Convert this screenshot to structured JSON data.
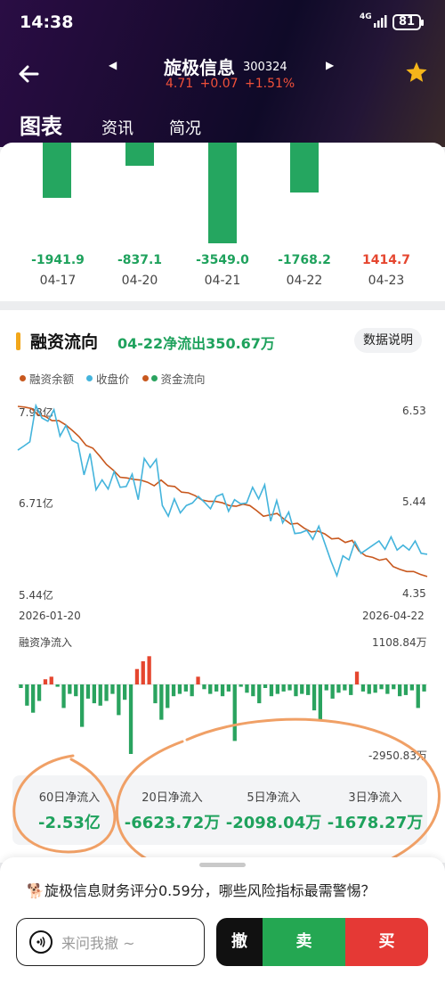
{
  "status_bar": {
    "time": "14:38",
    "network": "4G",
    "battery": "81"
  },
  "header": {
    "stock_name": "旋极信息",
    "stock_code": "300324",
    "quote": "4.71 +0.07 +1.51%",
    "tabs": [
      "图表",
      "资讯",
      "简况"
    ]
  },
  "daily_flows": {
    "items": [
      {
        "value": "-1941.9",
        "date": "04-17",
        "color": "#1fa25d"
      },
      {
        "value": "-837.1",
        "date": "04-20",
        "color": "#1fa25d"
      },
      {
        "value": "-3549.0",
        "date": "04-21",
        "color": "#1fa25d"
      },
      {
        "value": "-1768.2",
        "date": "04-22",
        "color": "#1fa25d"
      },
      {
        "value": "1414.7",
        "date": "04-23",
        "color": "#e5462f"
      }
    ]
  },
  "margin": {
    "title": "融资流向",
    "subtitle": "04-22净流出350.67万",
    "info_button": "数据说明",
    "legend": [
      "融资余额",
      "收盘价",
      "资金流向"
    ],
    "y_left": [
      "7.98亿",
      "6.71亿",
      "5.44亿"
    ],
    "y_right": [
      "6.53",
      "5.44",
      "4.35"
    ],
    "x_labels": [
      "2026-01-20",
      "2026-04-22"
    ],
    "flow_title": "融资净流入",
    "flow_max": "1108.84万",
    "flow_min": "-2950.83万",
    "summary": [
      {
        "label": "60日净流入",
        "value": "-2.53亿"
      },
      {
        "label": "20日净流入",
        "value": "-6623.72万"
      },
      {
        "label": "5日净流入",
        "value": "-2098.04万"
      },
      {
        "label": "3日净流入",
        "value": "-1678.27万"
      }
    ]
  },
  "chart_data": {
    "type": "line",
    "x_range": [
      "2026-01-20",
      "2026-04-22"
    ],
    "series": [
      {
        "name": "融资余额",
        "axis": "left",
        "unit": "亿",
        "color": "#c8581e",
        "values": [
          7.98,
          7.97,
          7.95,
          7.86,
          7.84,
          7.78,
          7.78,
          7.72,
          7.64,
          7.55,
          7.43,
          7.39,
          7.28,
          7.16,
          7.08,
          6.98,
          6.97,
          6.95,
          6.94,
          6.91,
          6.86,
          6.94,
          6.86,
          6.85,
          6.77,
          6.76,
          6.72,
          6.66,
          6.64,
          6.64,
          6.62,
          6.58,
          6.57,
          6.6,
          6.58,
          6.51,
          6.43,
          6.45,
          6.47,
          6.39,
          6.32,
          6.33,
          6.26,
          6.21,
          6.22,
          6.18,
          6.11,
          6.12,
          6.06,
          6.09,
          5.94,
          5.87,
          5.85,
          5.81,
          5.83,
          5.72,
          5.68,
          5.65,
          5.65,
          5.61,
          5.58
        ]
      },
      {
        "name": "收盘价",
        "axis": "right",
        "color": "#44b4dc",
        "values": [
          6.0,
          6.05,
          6.1,
          6.54,
          6.39,
          6.35,
          6.49,
          6.17,
          6.3,
          6.12,
          6.08,
          5.7,
          5.96,
          5.52,
          5.64,
          5.53,
          5.74,
          5.55,
          5.56,
          5.71,
          5.4,
          5.9,
          5.79,
          5.89,
          5.33,
          5.2,
          5.41,
          5.24,
          5.33,
          5.36,
          5.44,
          5.37,
          5.29,
          5.44,
          5.47,
          5.26,
          5.4,
          5.35,
          5.36,
          5.55,
          5.41,
          5.58,
          5.14,
          5.39,
          5.12,
          5.25,
          4.99,
          5.0,
          5.03,
          4.92,
          5.08,
          4.87,
          4.66,
          4.48,
          4.72,
          4.67,
          4.89,
          4.75,
          4.8,
          4.85,
          4.9,
          4.8,
          4.95,
          4.79,
          4.85,
          4.79,
          4.9,
          4.75,
          4.74
        ]
      }
    ],
    "flow": {
      "name": "融资净流入",
      "unit": "万",
      "max": 1108.84,
      "min": -2950.83,
      "values": [
        -150,
        -900,
        -1200,
        -700,
        200,
        300,
        -100,
        -1000,
        -400,
        -500,
        -1800,
        -600,
        -800,
        -900,
        -700,
        -400,
        -1300,
        -650,
        -2950,
        600,
        900,
        1100,
        -800,
        -1500,
        -1000,
        -500,
        -400,
        -300,
        -500,
        300,
        -200,
        -400,
        -300,
        -500,
        -300,
        -2400,
        -100,
        -350,
        -500,
        -800,
        -150,
        -500,
        -400,
        -300,
        -250,
        -500,
        -400,
        -450,
        -1100,
        -1500,
        -250,
        -600,
        -350,
        -250,
        -450,
        500,
        -300,
        -400,
        -350,
        -200,
        -400,
        -200,
        -500,
        -450,
        -250,
        -1000,
        -300
      ]
    },
    "ylim_left": [
      5.44,
      7.98
    ],
    "ylim_right": [
      4.35,
      6.53
    ]
  },
  "bottom": {
    "promo": "旋极信息财务评分0.59分，哪些风险指标最需警惕？",
    "ask_placeholder": "来问我撤 ~",
    "cancel": "撤",
    "sell": "卖",
    "buy": "买"
  }
}
